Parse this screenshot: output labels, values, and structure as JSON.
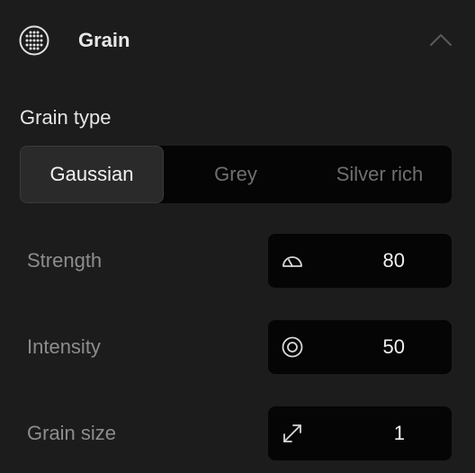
{
  "header": {
    "title": "Grain",
    "icon": "grain-dots-icon",
    "collapse_icon": "chevron-up-icon"
  },
  "grain_type": {
    "label": "Grain type",
    "options": [
      "Gaussian",
      "Grey",
      "Silver rich"
    ],
    "selected": "Gaussian"
  },
  "params": [
    {
      "label": "Strength",
      "value": "80",
      "icon": "gauge-icon"
    },
    {
      "label": "Intensity",
      "value": "50",
      "icon": "target-icon"
    },
    {
      "label": "Grain size",
      "value": "1",
      "icon": "resize-arrows-icon"
    }
  ],
  "colors": {
    "background": "#1c1c1c",
    "field_background": "#050505",
    "active_segment": "#2a2a2a",
    "label_muted": "#8d8d8d",
    "text": "#e6e6e6"
  }
}
